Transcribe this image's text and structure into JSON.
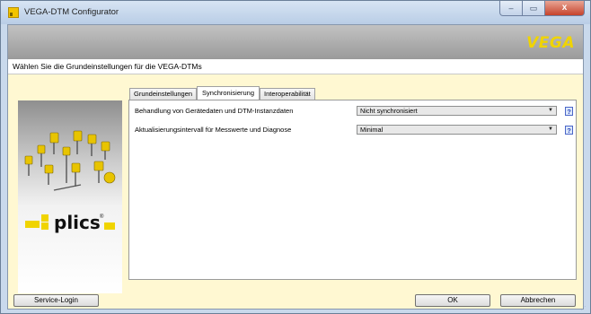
{
  "window": {
    "title": "VEGA-DTM Configurator",
    "controls": {
      "minimize": "–",
      "maximize": "▭",
      "close": "x"
    }
  },
  "banner": {
    "logo": "VEGA"
  },
  "subtitle": "Wählen Sie die Grundeinstellungen für die VEGA-DTMs",
  "tabs": [
    {
      "label": "Grundeinstellungen",
      "active": false
    },
    {
      "label": "Synchronisierung",
      "active": true
    },
    {
      "label": "Interoperabilität",
      "active": false
    }
  ],
  "image_panel": {
    "brand": "plics",
    "trademark": "®"
  },
  "settings": [
    {
      "label": "Behandlung von Gerätedaten und DTM-Instanzdaten",
      "value": "Nicht synchronisiert",
      "help": "?"
    },
    {
      "label": "Aktualisierungsintervall für Messwerte und Diagnose",
      "value": "Minimal",
      "help": "?"
    }
  ],
  "buttons": {
    "service_login": "Service-Login",
    "ok": "OK",
    "cancel": "Abbrechen"
  },
  "colors": {
    "vega_yellow": "#f0d400",
    "content_bg": "#fff8d2",
    "help_blue": "#2a44b8"
  }
}
